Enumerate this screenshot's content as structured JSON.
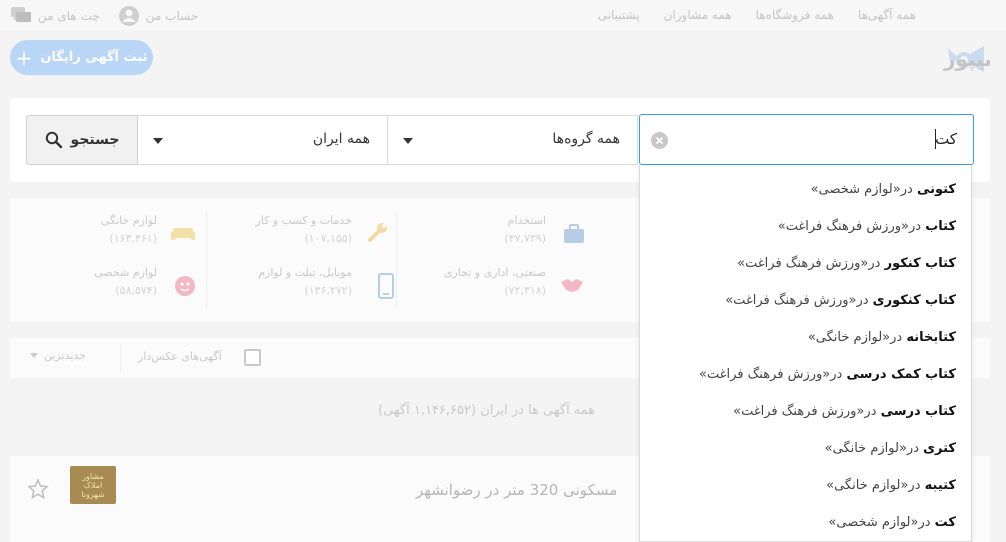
{
  "topbar": {
    "nav": [
      "همه آگهی‌ها",
      "همه فروشگاه‌ها",
      "همه مشاوران",
      "پشتیبانی"
    ],
    "chat_label": "چت های من",
    "account_label": "حساب من"
  },
  "header": {
    "logo_text": "شیپور",
    "post_ad_label": "ثبت آگهی رایگان"
  },
  "search": {
    "query": "کت",
    "category_select": "همه گروه‌ها",
    "city_select": "همه ایران",
    "button_label": "جستجو"
  },
  "suggestions": [
    {
      "term": "کتونی",
      "context": "در«لوازم شخصی»"
    },
    {
      "term": "کتاب",
      "context": "در«ورزش فرهنگ فراغت»"
    },
    {
      "term": "کتاب کنکور",
      "context": "در«ورزش فرهنگ فراغت»"
    },
    {
      "term": "کتاب کنکوری",
      "context": "در«ورزش فرهنگ فراغت»"
    },
    {
      "term": "کتابخانه",
      "context": "در«لوازم خانگی»"
    },
    {
      "term": "کتاب کمک درسی",
      "context": "در«ورزش فرهنگ فراغت»"
    },
    {
      "term": "کتاب درسی",
      "context": "در«ورزش فرهنگ فراغت»"
    },
    {
      "term": "کتری",
      "context": "در«لوازم خانگی»"
    },
    {
      "term": "کتیبه",
      "context": "در«لوازم خانگی»"
    },
    {
      "term": "کت",
      "context": "در«لوازم شخصی»"
    }
  ],
  "categories": [
    {
      "name": "استخدام",
      "count": "(۴۷,۷۳۹)",
      "icon": "briefcase-icon",
      "color": "#b7cde6"
    },
    {
      "name": "خدمات و کسب و کار",
      "count": "(۱۰۷,۱۵۵)",
      "icon": "wrench-icon",
      "color": "#f4d9a3"
    },
    {
      "name": "لوازم خانگی",
      "count": "(۱۶۳,۴۶۱)",
      "icon": "sofa-icon",
      "color": "#f4dfa8"
    },
    {
      "name": "صنعتی، اداری و تجاری",
      "count": "(۷۲,۳۱۸)",
      "icon": "handshake-icon",
      "color": "#f2b8c4"
    },
    {
      "name": "موبایل، تبلت و لوازم",
      "count": "(۱۳۶,۲۷۲)",
      "icon": "mobile-icon",
      "color": "#b7cde6"
    },
    {
      "name": "لوازم شخصی",
      "count": "(۵۸,۵۷۴)",
      "icon": "face-icon",
      "color": "#f2b8c4"
    }
  ],
  "filters": {
    "photo_only_label": "آگهی‌های عکس‌دار",
    "sort_label": "جدیدترین"
  },
  "results": {
    "title": "همه آگهی ها در ایران (۱,۱۴۶,۶۵۲ آگهی)"
  },
  "listing": {
    "title": "مسکونی 320 متر در رضوانشهر",
    "thumb_text": "مشاور املاک شهرونا"
  }
}
